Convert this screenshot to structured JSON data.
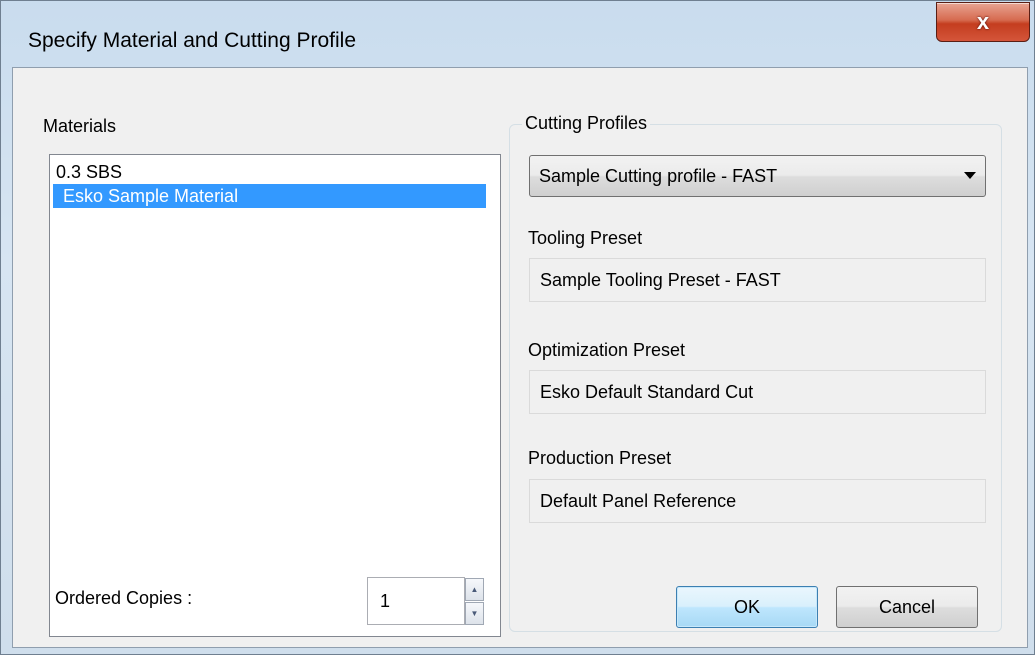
{
  "window": {
    "title": "Specify Material and Cutting Profile",
    "close_label": "x"
  },
  "materials": {
    "label": "Materials",
    "items": [
      {
        "label": "0.3 SBS",
        "selected": false
      },
      {
        "label": "Esko Sample Material",
        "selected": true
      }
    ]
  },
  "ordered_copies": {
    "label": "Ordered Copies :",
    "value": "1"
  },
  "cutting_profiles": {
    "group_label": "Cutting Profiles",
    "selected_profile": "Sample Cutting profile - FAST",
    "tooling_label": "Tooling Preset",
    "tooling_value": "Sample Tooling Preset - FAST",
    "optimization_label": "Optimization Preset",
    "optimization_value": "Esko Default Standard Cut",
    "production_label": "Production Preset",
    "production_value": "Default Panel Reference"
  },
  "buttons": {
    "ok": "OK",
    "cancel": "Cancel"
  },
  "colors": {
    "selection": "#3399ff",
    "close_button": "#c43d1f"
  }
}
